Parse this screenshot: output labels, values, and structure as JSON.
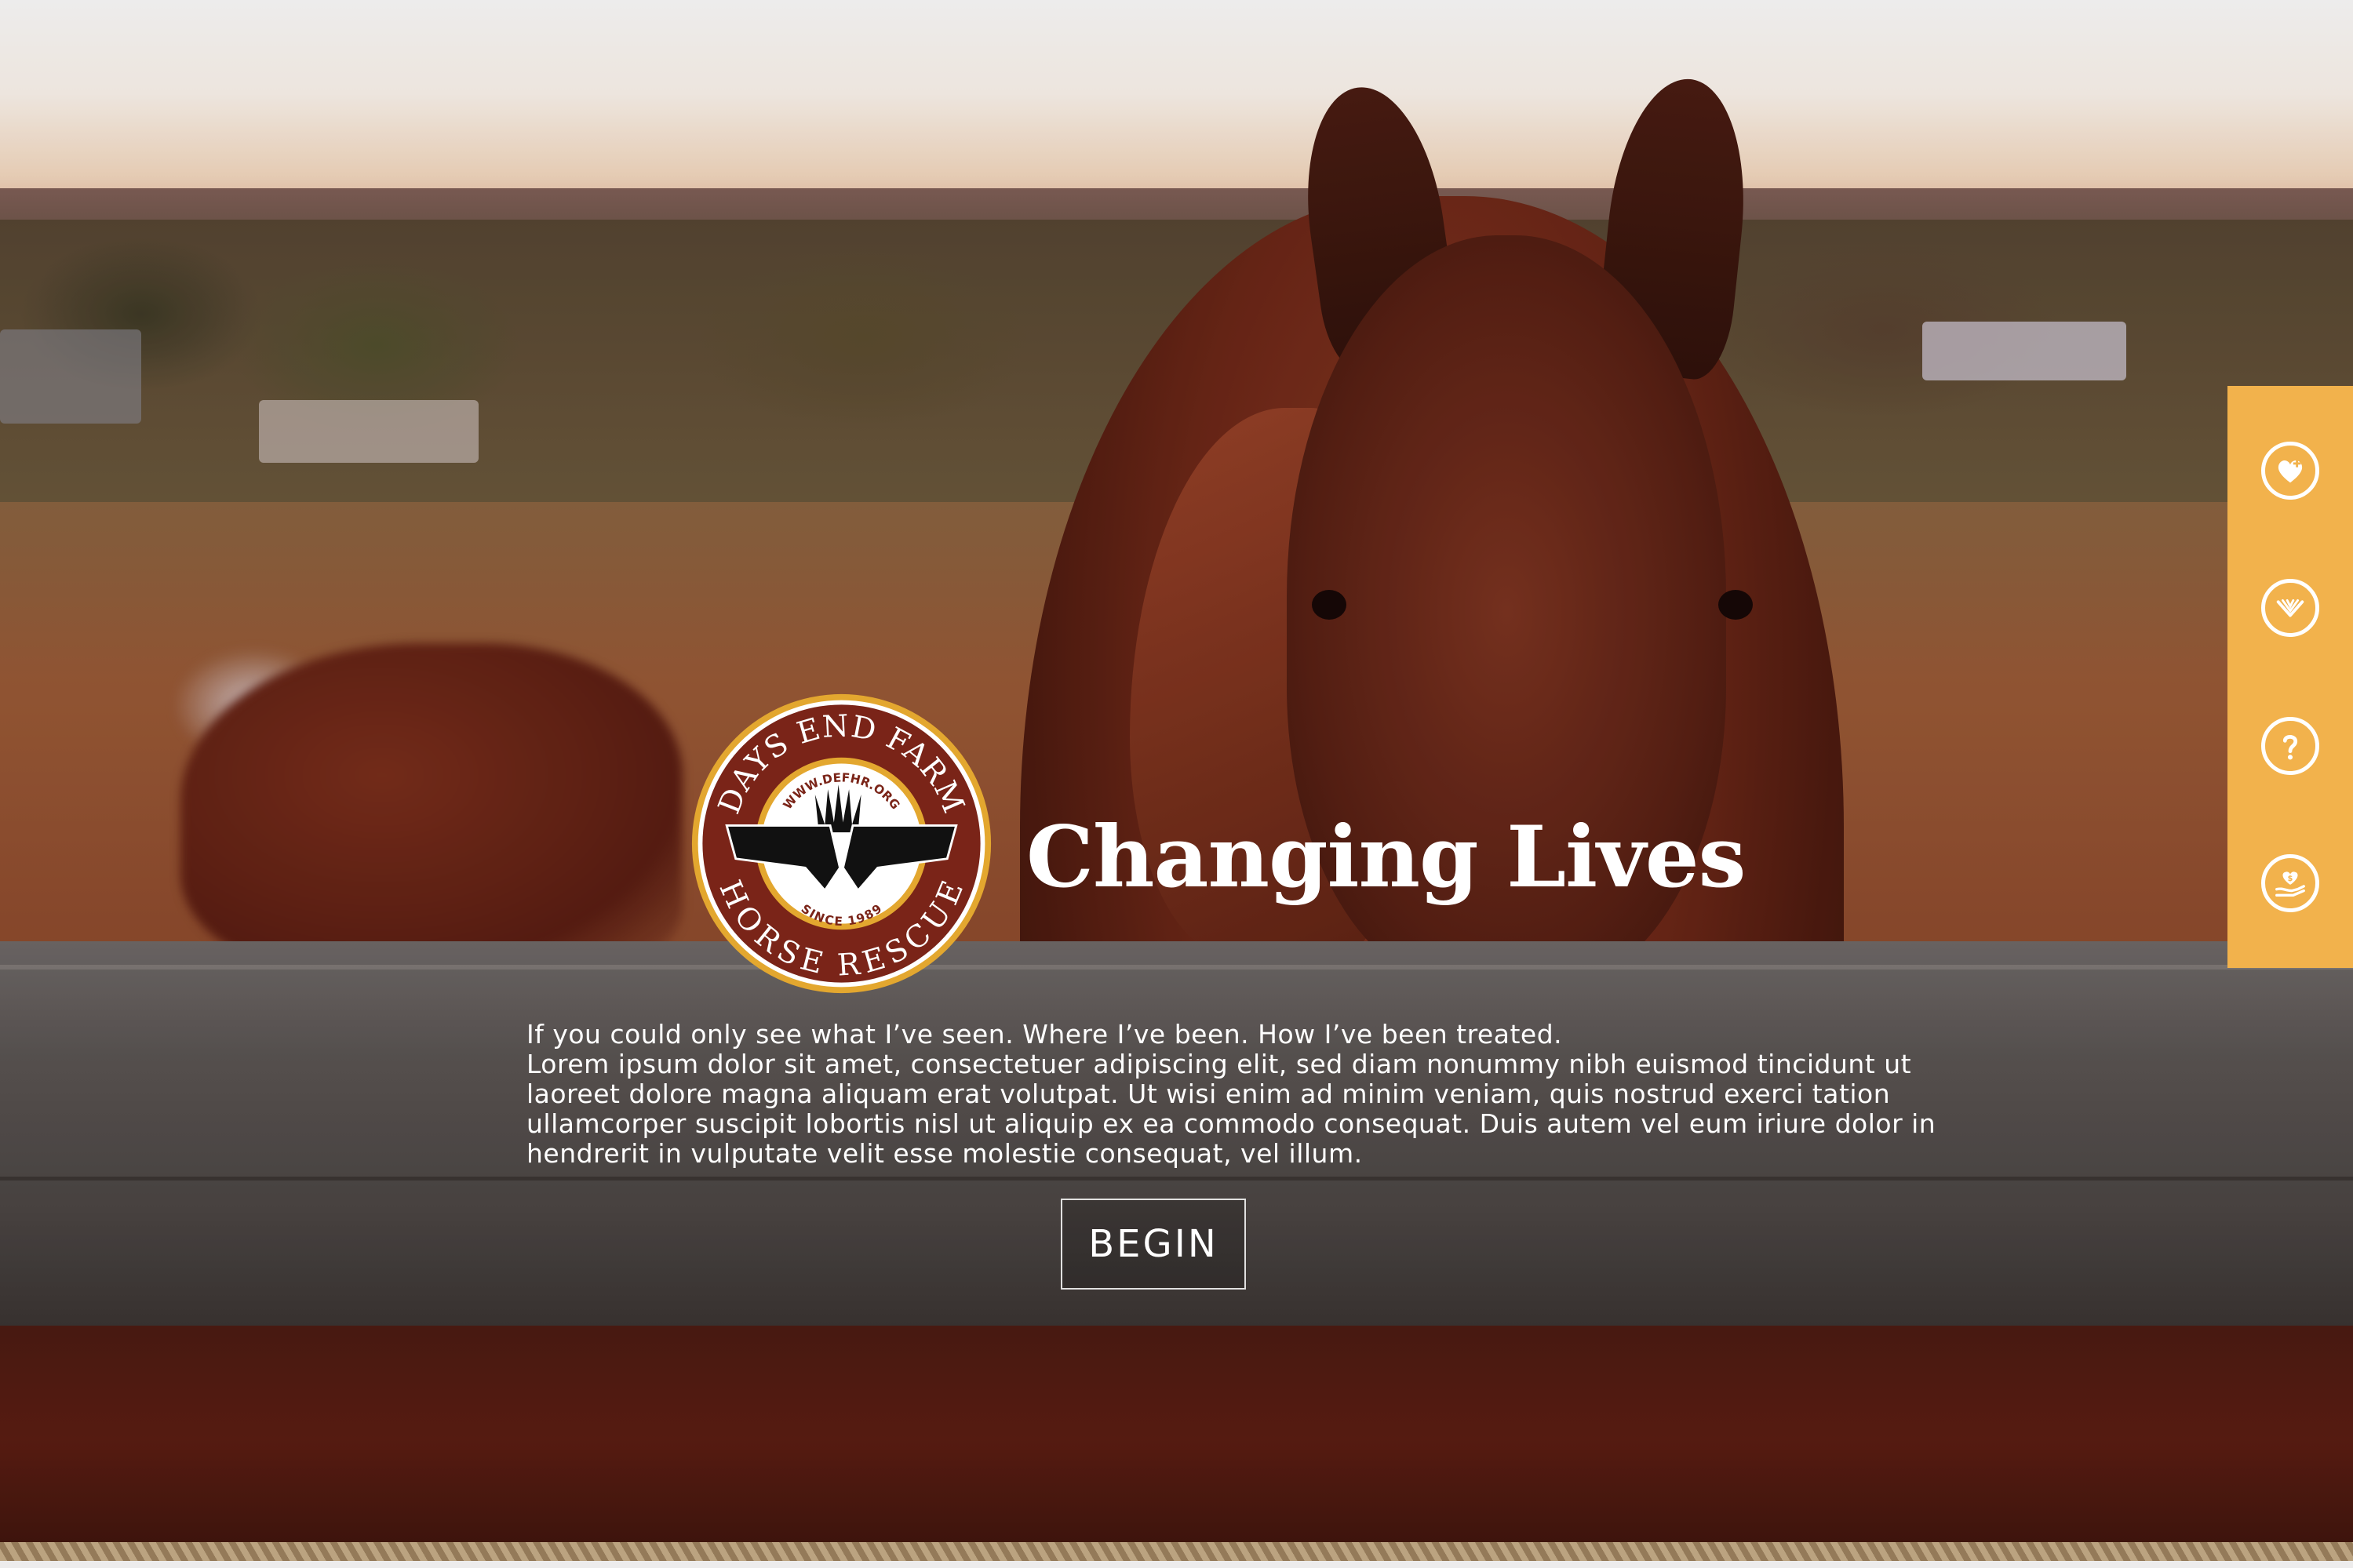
{
  "hero": {
    "title": "Changing Lives",
    "intro_lead": "If you could only see what I’ve seen. Where I’ve been. How I’ve been treated.",
    "intro_body": "Lorem ipsum dolor sit amet, consectetuer adipiscing elit, sed diam nonummy nibh euismod tincidunt ut laoreet dolore magna aliquam erat volutpat. Ut wisi enim ad minim veniam, quis nostrud exerci tation ullamcorper suscipit lobortis nisl ut aliquip ex ea commodo consequat. Duis autem vel eum iriure dolor in hendrerit in vulputate velit esse molestie consequat, vel illum.",
    "begin_label": "BEGIN"
  },
  "logo": {
    "top_text": "DAYS END FARM",
    "bottom_text": "HORSE RESCUE",
    "url_text": "WWW.DEFHR.ORG",
    "since_text": "SINCE 1989",
    "colors": {
      "ring": "#7a2418",
      "gold": "#e3a72f",
      "inner": "#ffffff",
      "dark": "#111111"
    }
  },
  "sidebar": {
    "color": "#f2b24c",
    "items": [
      {
        "icon": "heart-plus-icon"
      },
      {
        "icon": "hay-bale-icon"
      },
      {
        "icon": "question-icon"
      },
      {
        "icon": "donate-hand-icon"
      }
    ]
  }
}
